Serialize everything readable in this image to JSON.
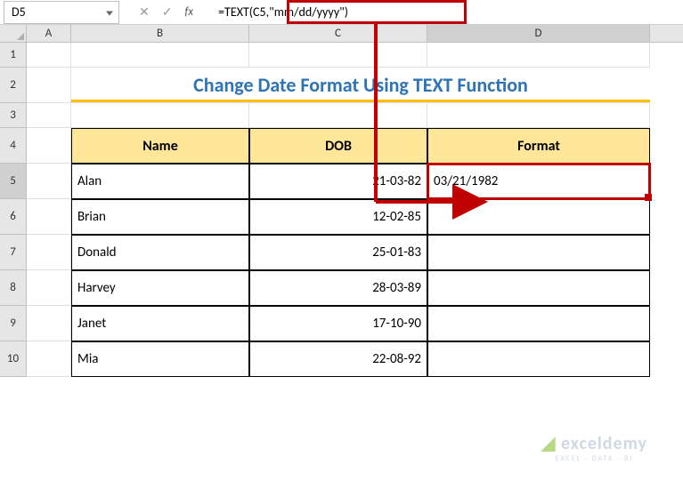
{
  "nameBox": "D5",
  "formula": "=TEXT(C5,\"mm/dd/yyyy\")",
  "columns": [
    "A",
    "B",
    "C",
    "D"
  ],
  "rows": [
    "1",
    "2",
    "3",
    "4",
    "5",
    "6",
    "7",
    "8",
    "9",
    "10"
  ],
  "title": "Change Date Format Using TEXT Function",
  "headers": {
    "name": "Name",
    "dob": "DOB",
    "format": "Format"
  },
  "data": [
    {
      "name": "Alan",
      "dob": "21-03-82",
      "format": "03/21/1982"
    },
    {
      "name": "Brian",
      "dob": "12-02-85",
      "format": ""
    },
    {
      "name": "Donald",
      "dob": "25-01-83",
      "format": ""
    },
    {
      "name": "Harvey",
      "dob": "28-03-89",
      "format": ""
    },
    {
      "name": "Janet",
      "dob": "17-10-90",
      "format": ""
    },
    {
      "name": "Mia",
      "dob": "22-08-92",
      "format": ""
    }
  ],
  "watermark": {
    "logo": "exceldemy",
    "tag": "EXCEL · DATA · BI"
  }
}
